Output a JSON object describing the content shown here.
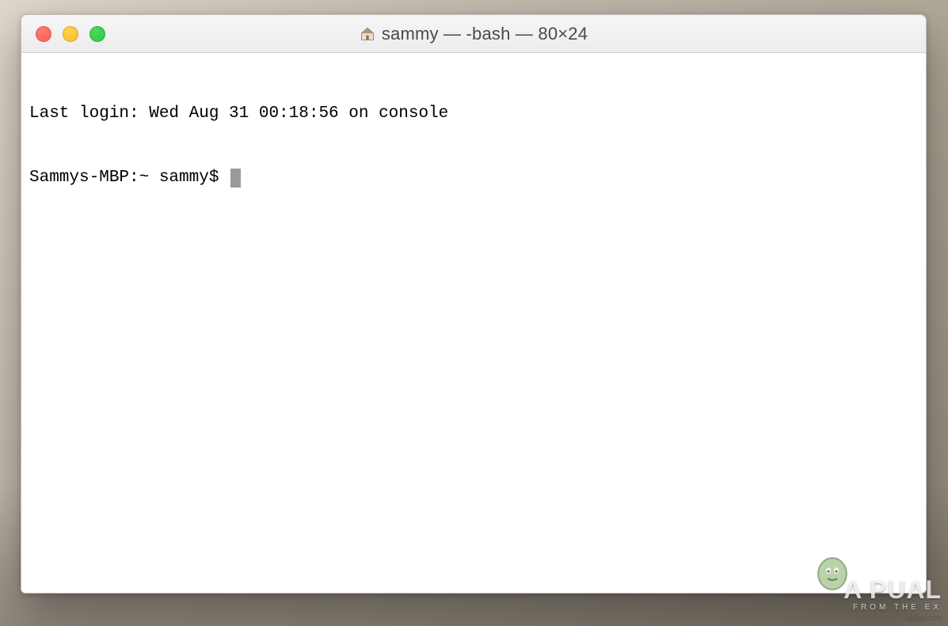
{
  "window": {
    "title": "sammy — -bash — 80×24",
    "traffic": {
      "close": "close",
      "minimize": "minimize",
      "maximize": "maximize"
    }
  },
  "terminal": {
    "lines": [
      "Last login: Wed Aug 31 00:18:56 on console"
    ],
    "prompt": "Sammys-MBP:~ sammy$ "
  },
  "watermark": {
    "main": "A PUAL",
    "sub": "FROM  THE  EX",
    "extra": "wsxn.com"
  }
}
